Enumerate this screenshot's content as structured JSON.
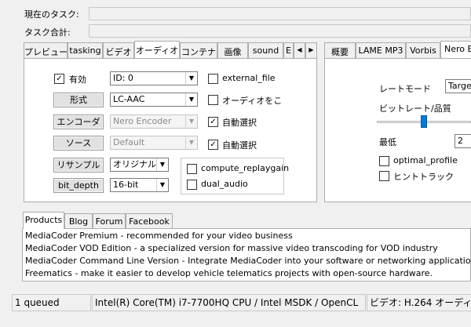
{
  "header": {
    "current_task_label": "現在のタスク:",
    "total_task_label": "タスク合計:"
  },
  "left_tabs": [
    "プレビュー",
    "tasking",
    "ビデオ",
    "オーディオ",
    "コンテナ",
    "画像",
    "sound",
    "E"
  ],
  "left_tab_nav": {
    "prev": "◀",
    "next": "▶"
  },
  "audio": {
    "enable_label": "有効",
    "enable_checked": true,
    "id_value": "ID: 0",
    "format_button": "形式",
    "format_value": "LC-AAC",
    "encoder_button": "エンコーダ",
    "encoder_value": "Nero Encoder",
    "source_button": "ソース",
    "source_value": "Default",
    "resample_button": "リサンプル",
    "resample_value": "オリジナル",
    "bitdepth_button": "bit_depth",
    "bitdepth_value": "16-bit",
    "external_file_label": "external_file",
    "external_file_checked": false,
    "audio_opt_label": "オーディオをこ",
    "audio_opt_checked": false,
    "auto_select1_label": "自動選択",
    "auto_select1_checked": true,
    "auto_select2_label": "自動選択",
    "auto_select2_checked": true,
    "replaygain_label": "compute_replaygain",
    "replaygain_checked": false,
    "dual_audio_label": "dual_audio",
    "dual_audio_checked": false
  },
  "right_tabs": [
    "概要",
    "LAME MP3",
    "Vorbis",
    "Nero En"
  ],
  "nero": {
    "rate_mode_label": "レートモード",
    "rate_mode_value": "Target",
    "bitrate_label": "ビットレート/品質",
    "bitrate_level": 0.25,
    "min_label": "最低",
    "min_value": "2",
    "optimal_profile_label": "optimal_profile",
    "optimal_profile_checked": false,
    "hint_track_label": "ヒントトラック",
    "hint_track_checked": false
  },
  "bottom_tabs": [
    "Products",
    "Blog",
    "Forum",
    "Facebook"
  ],
  "products": [
    "MediaCoder Premium - recommended for your video business",
    "MediaCoder VOD Edition - a specialized version for massive video transcoding for VOD industry",
    "MediaCoder Command Line Version - Integrate MediaCoder into your software or networking application",
    "Freematics - make it easier to develop vehicle telematics projects with open-source hardware."
  ],
  "status": {
    "queued": "1 queued",
    "cpu": "Intel(R) Core(TM) i7-7700HQ CPU  / Intel MSDK / OpenCL",
    "video": "ビデオ: H.264  オーディ"
  },
  "colors": {
    "selection": "#0078d7",
    "window_bg": "#f0f0f0",
    "panel_bg": "#ffffff"
  }
}
